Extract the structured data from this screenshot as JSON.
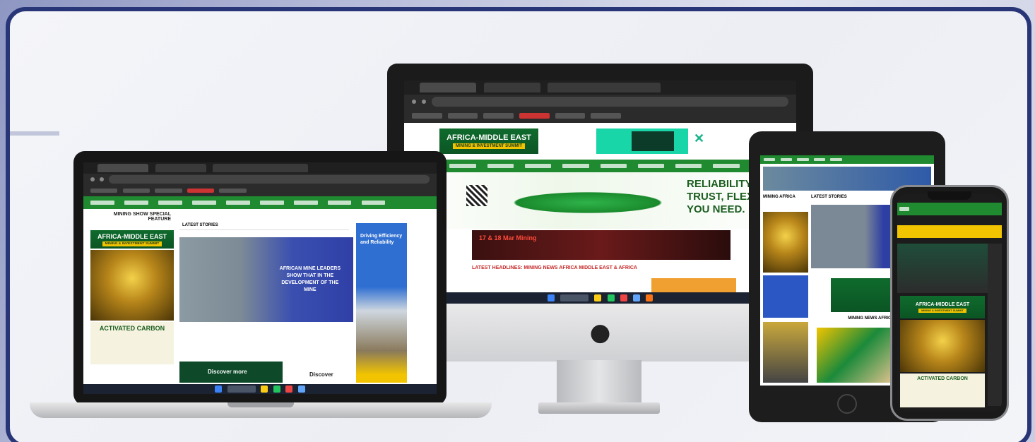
{
  "imac": {
    "header_ad": {
      "title": "AFRICA-MIDDLE EAST",
      "subtitle": "MINING & INVESTMENT SUMMIT"
    },
    "banner_text": [
      "RELIABILITY YO",
      "TRUST, FLEXIB",
      "YOU NEED."
    ],
    "section_heading": "LATEST HEADLINES: MINING NEWS AFRICA MIDDLE EAST & AFRICA",
    "promo_text": "17 & 18 Mar  Mining"
  },
  "laptop": {
    "sidebar_heading": [
      "MINING SHOW SPECIAL",
      "FEATURE"
    ],
    "latest_label": "LATEST STORIES",
    "side_ad": {
      "title": "AFRICA-MIDDLE EAST",
      "subtitle": "MINING & INVESTMENT SUMMIT"
    },
    "carbon_ad": "ACTIVATED CARBON",
    "hero_text": [
      "AFRICAN MINE LEADERS",
      "SHOW THAT IN THE",
      "DEVELOPMENT OF THE",
      "MINE"
    ],
    "right_ad": [
      "Driving Efficiency",
      "and Reliability"
    ],
    "bottom_ad_left": "Discover more",
    "bottom_ad_right": "Discover"
  },
  "tablet": {
    "latest_label": "LATEST STORIES",
    "side_text": "MINING AFRICA",
    "bottom_heading": "MINING NEWS AFRICA"
  },
  "phone": {
    "ad": {
      "title": "AFRICA-MIDDLE EAST",
      "subtitle": "MINING & INVESTMENT SUMMIT"
    },
    "carbon_ad": "ACTIVATED CARBON"
  },
  "colors": {
    "frame_border": "#283577",
    "nav_green": "#1f8a2f",
    "ad_yellow": "#f2c400"
  }
}
